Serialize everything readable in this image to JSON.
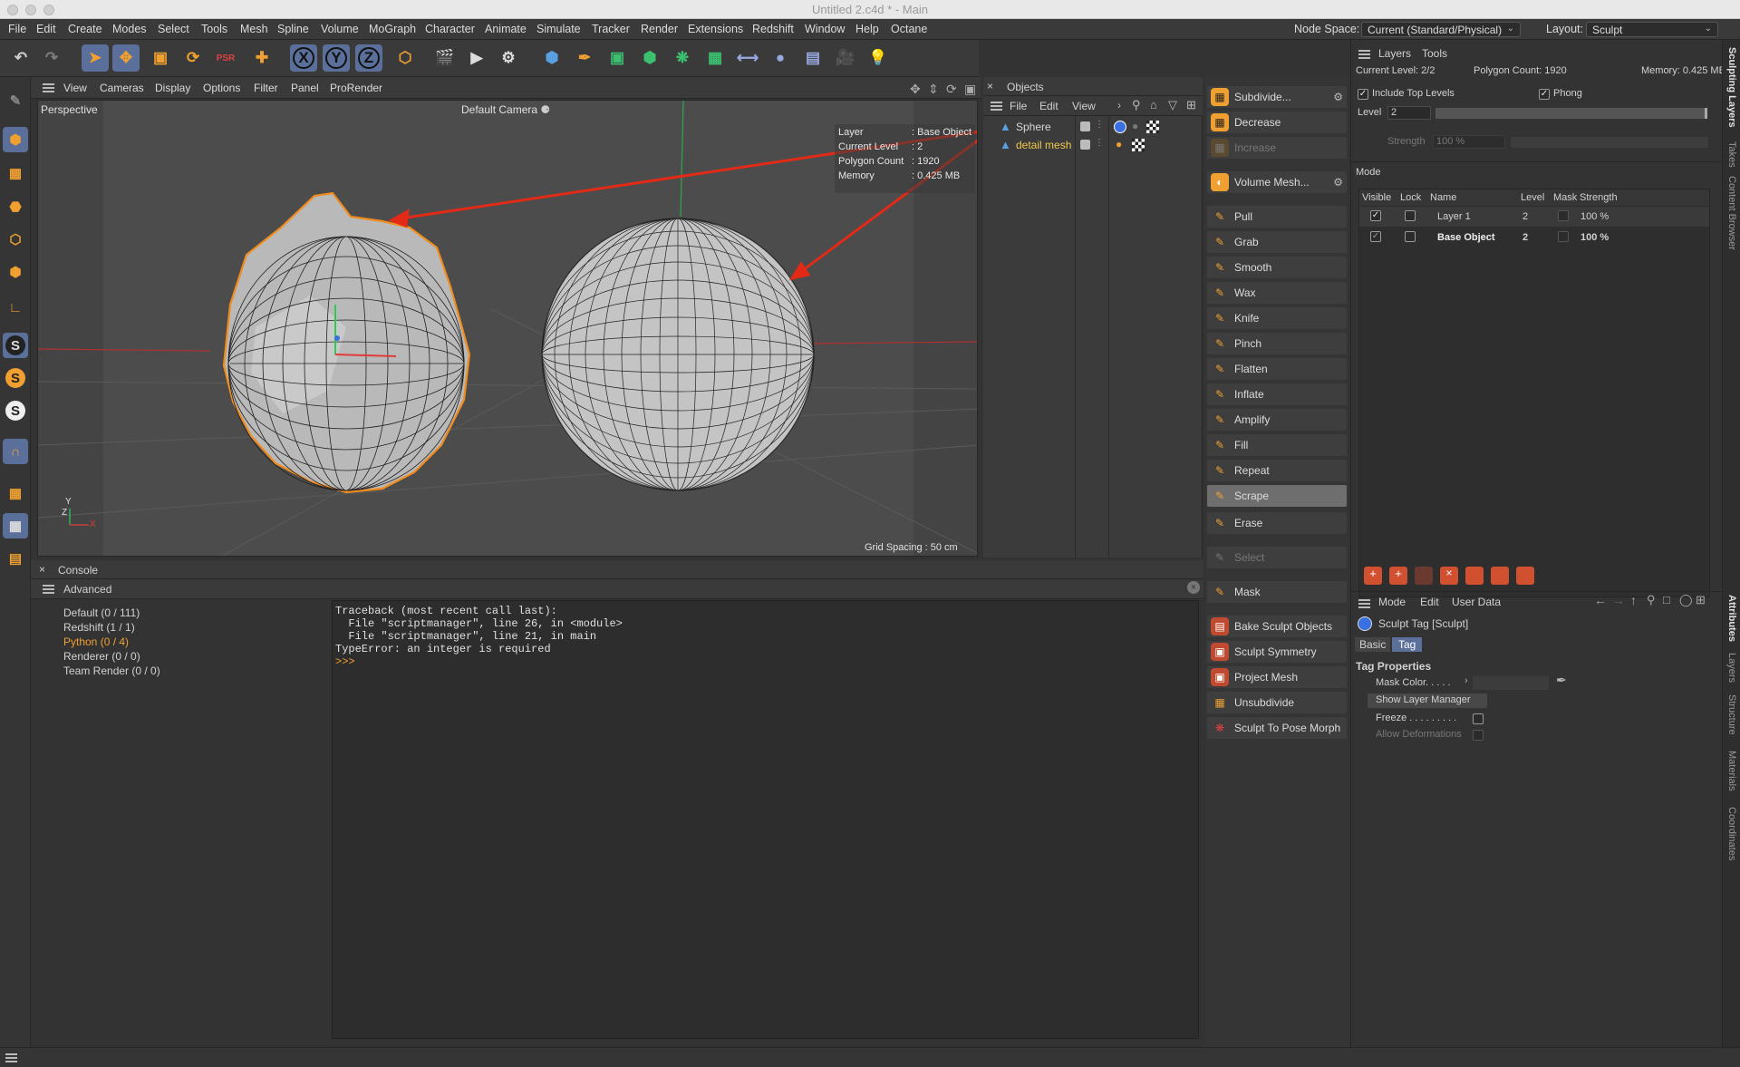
{
  "window": {
    "title": "Untitled 2.c4d * - Main"
  },
  "menubar": {
    "items": [
      "File",
      "Edit",
      "Create",
      "Modes",
      "Select",
      "Tools",
      "Mesh",
      "Spline",
      "Volume",
      "MoGraph",
      "Character",
      "Animate",
      "Simulate",
      "Tracker",
      "Render",
      "Extensions",
      "Redshift",
      "Window",
      "Help",
      "Octane"
    ],
    "node_space_label": "Node Space:",
    "node_space_value": "Current (Standard/Physical)",
    "layout_label": "Layout:",
    "layout_value": "Sculpt"
  },
  "toolbar": {
    "axis_x": "X",
    "axis_y": "Y",
    "axis_z": "Z"
  },
  "left_palette": {
    "s_labels": [
      "S",
      "S",
      "S"
    ]
  },
  "viewport": {
    "menu": [
      "View",
      "Cameras",
      "Display",
      "Options",
      "Filter",
      "Panel",
      "ProRender"
    ],
    "view_name": "Perspective",
    "camera": "Default Camera",
    "hud": [
      {
        "label": "Layer",
        "value": ": Base Object"
      },
      {
        "label": "Current Level",
        "value": ": 2"
      },
      {
        "label": "Polygon Count",
        "value": ": 1920"
      },
      {
        "label": "Memory",
        "value": ": 0.425 MB"
      }
    ],
    "grid_spacing": "Grid Spacing : 50 cm",
    "axis_y": "Y",
    "axis_z": "Z",
    "axis_x": "X"
  },
  "objects": {
    "title": "Objects",
    "menu": [
      "File",
      "Edit",
      "View"
    ],
    "items": [
      {
        "name": "Sphere",
        "color": "#d8d8d8"
      },
      {
        "name": "detail mesh",
        "color": "#f2c94c"
      }
    ]
  },
  "sculpt_tools": {
    "top": [
      {
        "label": "Subdivide...",
        "state": "normal"
      },
      {
        "label": "Decrease",
        "state": "normal"
      },
      {
        "label": "Increase",
        "state": "off"
      }
    ],
    "volume": "Volume Mesh...",
    "brushes": [
      {
        "label": "Pull",
        "state": "normal"
      },
      {
        "label": "Grab",
        "state": "normal"
      },
      {
        "label": "Smooth",
        "state": "normal"
      },
      {
        "label": "Wax",
        "state": "normal"
      },
      {
        "label": "Knife",
        "state": "normal"
      },
      {
        "label": "Pinch",
        "state": "normal"
      },
      {
        "label": "Flatten",
        "state": "normal"
      },
      {
        "label": "Inflate",
        "state": "normal"
      },
      {
        "label": "Amplify",
        "state": "normal"
      },
      {
        "label": "Fill",
        "state": "normal"
      },
      {
        "label": "Repeat",
        "state": "normal"
      },
      {
        "label": "Scrape",
        "state": "sel"
      },
      {
        "label": "Erase",
        "state": "normal"
      }
    ],
    "select": "Select",
    "mask": "Mask",
    "bottom": [
      "Bake Sculpt Objects",
      "Sculpt Symmetry",
      "Project Mesh",
      "Unsubdivide",
      "Sculpt To Pose Morph"
    ]
  },
  "layers_panel": {
    "tabs": [
      "Layers",
      "Tools"
    ],
    "current_level": "Current Level: 2/2",
    "polygon_count": "Polygon Count: 1920",
    "memory": "Memory: 0.425 MB",
    "include_top_levels": "Include Top Levels",
    "phong": "Phong",
    "level_label": "Level",
    "level_value": "2",
    "strength_label": "Strength",
    "strength_value": "100 %",
    "mode_label": "Mode",
    "columns": [
      "Visible",
      "Lock",
      "Name",
      "Level",
      "Mask",
      "Strength"
    ],
    "rows": [
      {
        "name": "Layer 1",
        "level": "2",
        "strength": "100 %"
      },
      {
        "name": "Base Object",
        "level": "2",
        "strength": "100 %"
      }
    ]
  },
  "attributes": {
    "menu": [
      "Mode",
      "Edit",
      "User Data"
    ],
    "tag_name": "Sculpt Tag [Sculpt]",
    "tabs": [
      "Basic",
      "Tag"
    ],
    "section": "Tag Properties",
    "mask_color": "Mask Color. . . . .",
    "show_layer_manager": "Show Layer Manager",
    "freeze": "Freeze . . . . . . . . .",
    "allow_deformations": "Allow Deformations"
  },
  "side_tabs": [
    "Sculpting Layers",
    "Takes",
    "Content Browser",
    "Attributes",
    "Layers",
    "Structure",
    "Materials",
    "Coordinates"
  ],
  "console": {
    "title": "Console",
    "menu_label": "Advanced",
    "channels": [
      {
        "label": "Default (0 / 111)",
        "color": "#d2d2d2"
      },
      {
        "label": "Redshift (1 / 1)",
        "color": "#d2d2d2"
      },
      {
        "label": "Python (0 / 4)",
        "color": "#f0a030"
      },
      {
        "label": "Renderer (0 / 0)",
        "color": "#d2d2d2"
      },
      {
        "label": "Team Render  (0 / 0)",
        "color": "#d2d2d2"
      }
    ],
    "output": [
      "Traceback (most recent call last):",
      "  File \"scriptmanager\", line 26, in <module>",
      "  File \"scriptmanager\", line 21, in main",
      "TypeError: an integer is required"
    ],
    "prompt": ">>>"
  }
}
